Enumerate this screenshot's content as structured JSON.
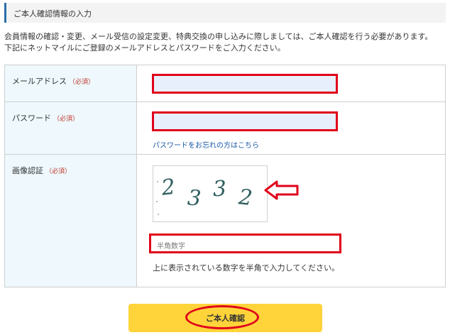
{
  "section": {
    "title": "ご本人確認情報の入力"
  },
  "intro": {
    "line1": "会員情報の確認・変更、メール受信の設定変更、特典交換の申し込みに際しましては、ご本人確認を行う必要があります。",
    "line2": "下記にネットマイルにご登録のメールアドレスとパスワードをご入力ください。"
  },
  "form": {
    "required_tag": "（必須）",
    "email": {
      "label": "メールアドレス",
      "value": ""
    },
    "password": {
      "label": "パスワード",
      "value": "",
      "forgot_link": "パスワードをお忘れの方はこちら"
    },
    "captcha": {
      "label": "画像認証",
      "digits": [
        "2",
        "3",
        "3",
        "2"
      ],
      "placeholder": "半角数字",
      "hint": "上に表示されている数字を半角で入力してください。"
    }
  },
  "submit": {
    "label": "ご本人確認"
  },
  "colors": {
    "highlight": "#e0001a",
    "button": "#ffd43a",
    "label_bg": "#eef8fd",
    "header_bar": "#2c6ea8"
  }
}
